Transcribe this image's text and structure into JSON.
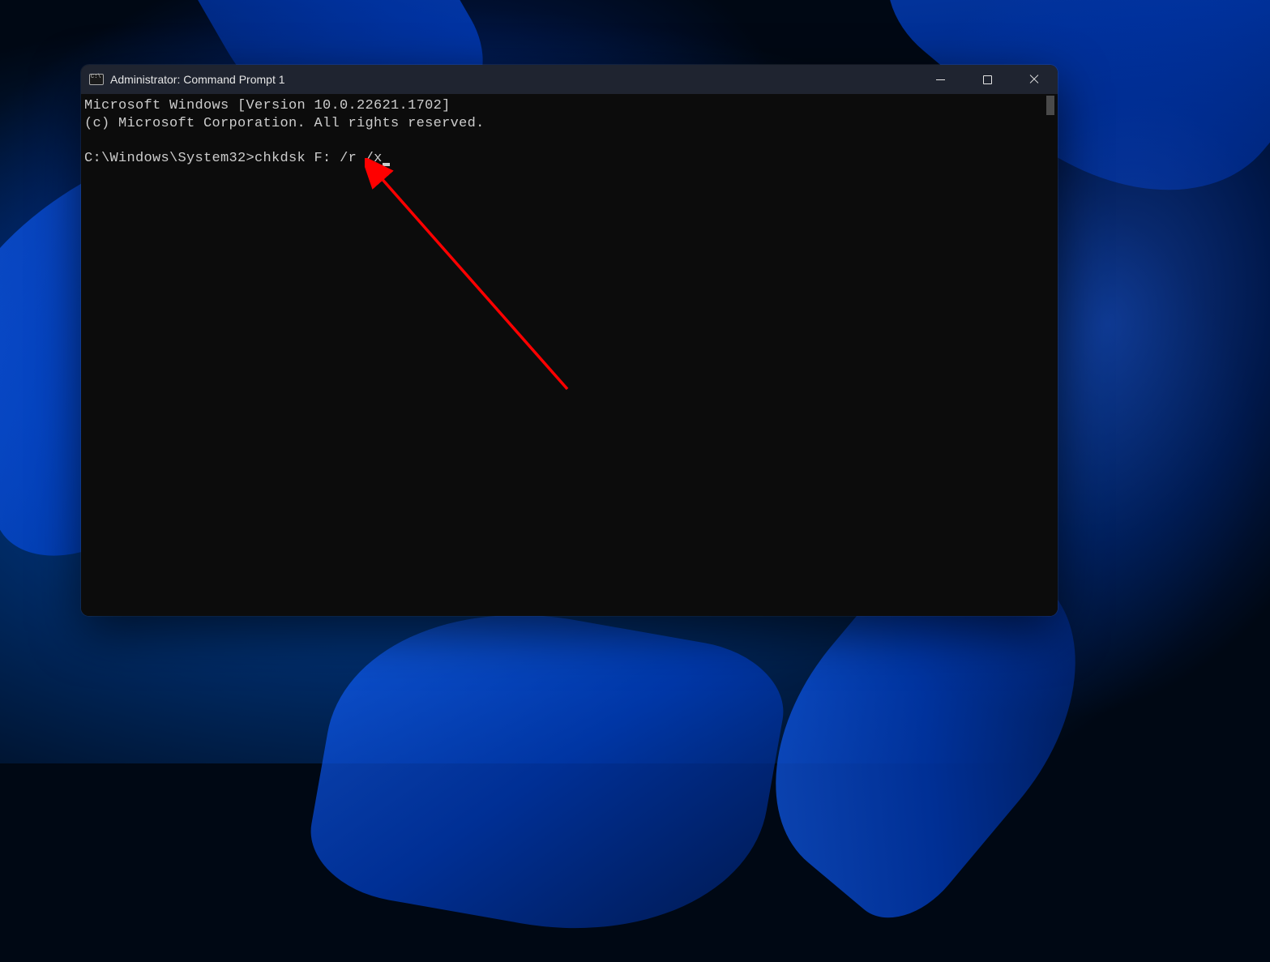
{
  "window": {
    "title": "Administrator: Command Prompt 1"
  },
  "terminal": {
    "line1": "Microsoft Windows [Version 10.0.22621.1702]",
    "line2": "(c) Microsoft Corporation. All rights reserved.",
    "prompt": "C:\\Windows\\System32>",
    "command": "chkdsk F: /r /x"
  },
  "icons": {
    "minimize": "minimize-icon",
    "maximize": "maximize-icon",
    "close": "close-icon",
    "cmd": "cmd-icon"
  }
}
